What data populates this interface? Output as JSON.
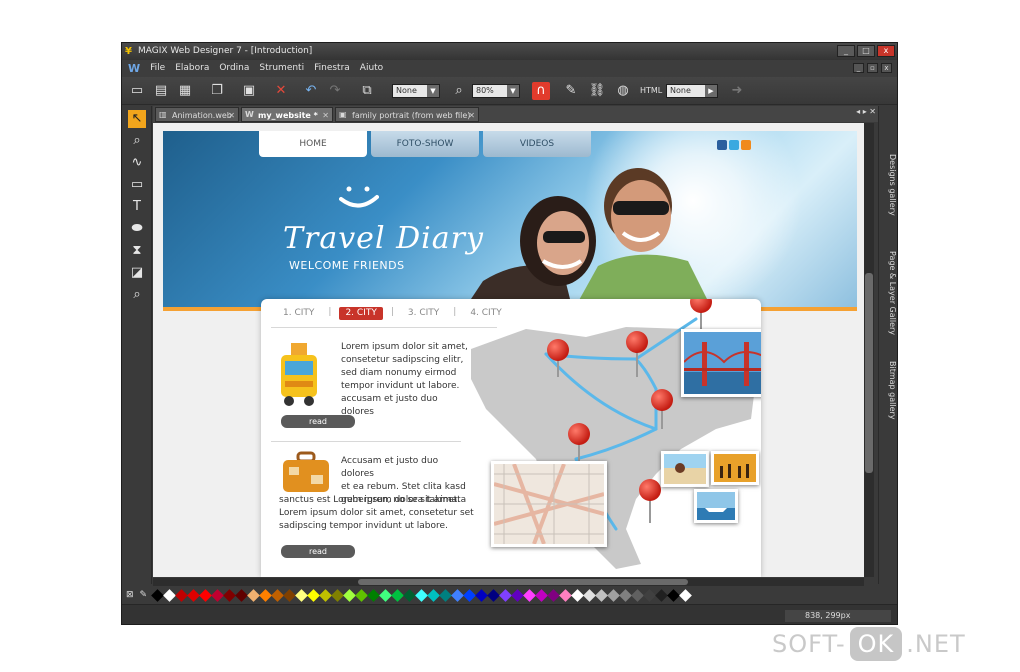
{
  "window": {
    "title": "MAGIX Web Designer 7 - [Introduction]",
    "controls": {
      "minimize": "_",
      "maximize": "□",
      "close": "x"
    }
  },
  "menu": {
    "logo": "W",
    "items": [
      "File",
      "Elabora",
      "Ordina",
      "Strumenti",
      "Finestra",
      "Aiuto"
    ]
  },
  "toolbar": {
    "select_none_1": "None",
    "zoom": "80%",
    "select_none_2": "None"
  },
  "tabs": [
    {
      "label": "Animation.web",
      "active": false
    },
    {
      "label": "my_website *",
      "active": true
    },
    {
      "label": "family portrait  (from web file)",
      "active": false
    }
  ],
  "site": {
    "nav": [
      "HOME",
      "FOTO-SHOW",
      "VIDEOS"
    ],
    "brand": "Travel Diary",
    "tagline": "WELCOME FRIENDS",
    "city_tabs": [
      "1. CITY",
      "2. CITY",
      "3. CITY",
      "4. CITY"
    ],
    "active_city": 1,
    "articles": [
      {
        "lines": [
          "Lorem ipsum dolor sit amet,",
          "consetetur sadipscing elitr,",
          "sed diam nonumy eirmod",
          "tempor invidunt ut labore.",
          "accusam et justo duo dolores"
        ],
        "read": "read"
      },
      {
        "lines": [
          "Accusam et justo duo dolores",
          "et ea rebum. Stet clita kasd",
          "gubergren, no sea takimata",
          "sanctus est Lorem ipsum dolor sit amet.",
          "Lorem ipsum dolor sit amet, consetetur set",
          "sadipscing tempor invidunt ut labore."
        ],
        "read": "read"
      }
    ]
  },
  "right_panels": [
    "Designs gallery",
    "Page & Layer Gallery",
    "Bitmap gallery"
  ],
  "status": {
    "coords": "838, 299px"
  },
  "palette": [
    "#000000",
    "#ffffff",
    "#c00000",
    "#e00000",
    "#ff0000",
    "#c00030",
    "#800000",
    "#600000",
    "#f0b070",
    "#ff8000",
    "#c06000",
    "#804000",
    "#ffff80",
    "#ffff00",
    "#c0c000",
    "#808000",
    "#a0ff40",
    "#60c000",
    "#008000",
    "#40ff80",
    "#00c040",
    "#006030",
    "#40ffff",
    "#00c0c0",
    "#008080",
    "#4080ff",
    "#0040ff",
    "#0000c0",
    "#000080",
    "#8040ff",
    "#6000c0",
    "#ff40ff",
    "#c000c0",
    "#800080",
    "#ff80c0",
    "#ffffff",
    "#e0e0e0",
    "#c0c0c0",
    "#a0a0a0",
    "#808080",
    "#606060",
    "#404040",
    "#202020",
    "#000000",
    "#ffffff"
  ],
  "watermark": {
    "left": "SOFT-",
    "ok": "OK",
    "right": ".NET"
  },
  "colors": {
    "accent": "#f2a51c",
    "brand_red": "#c8342a",
    "route": "#5bb8ea"
  }
}
